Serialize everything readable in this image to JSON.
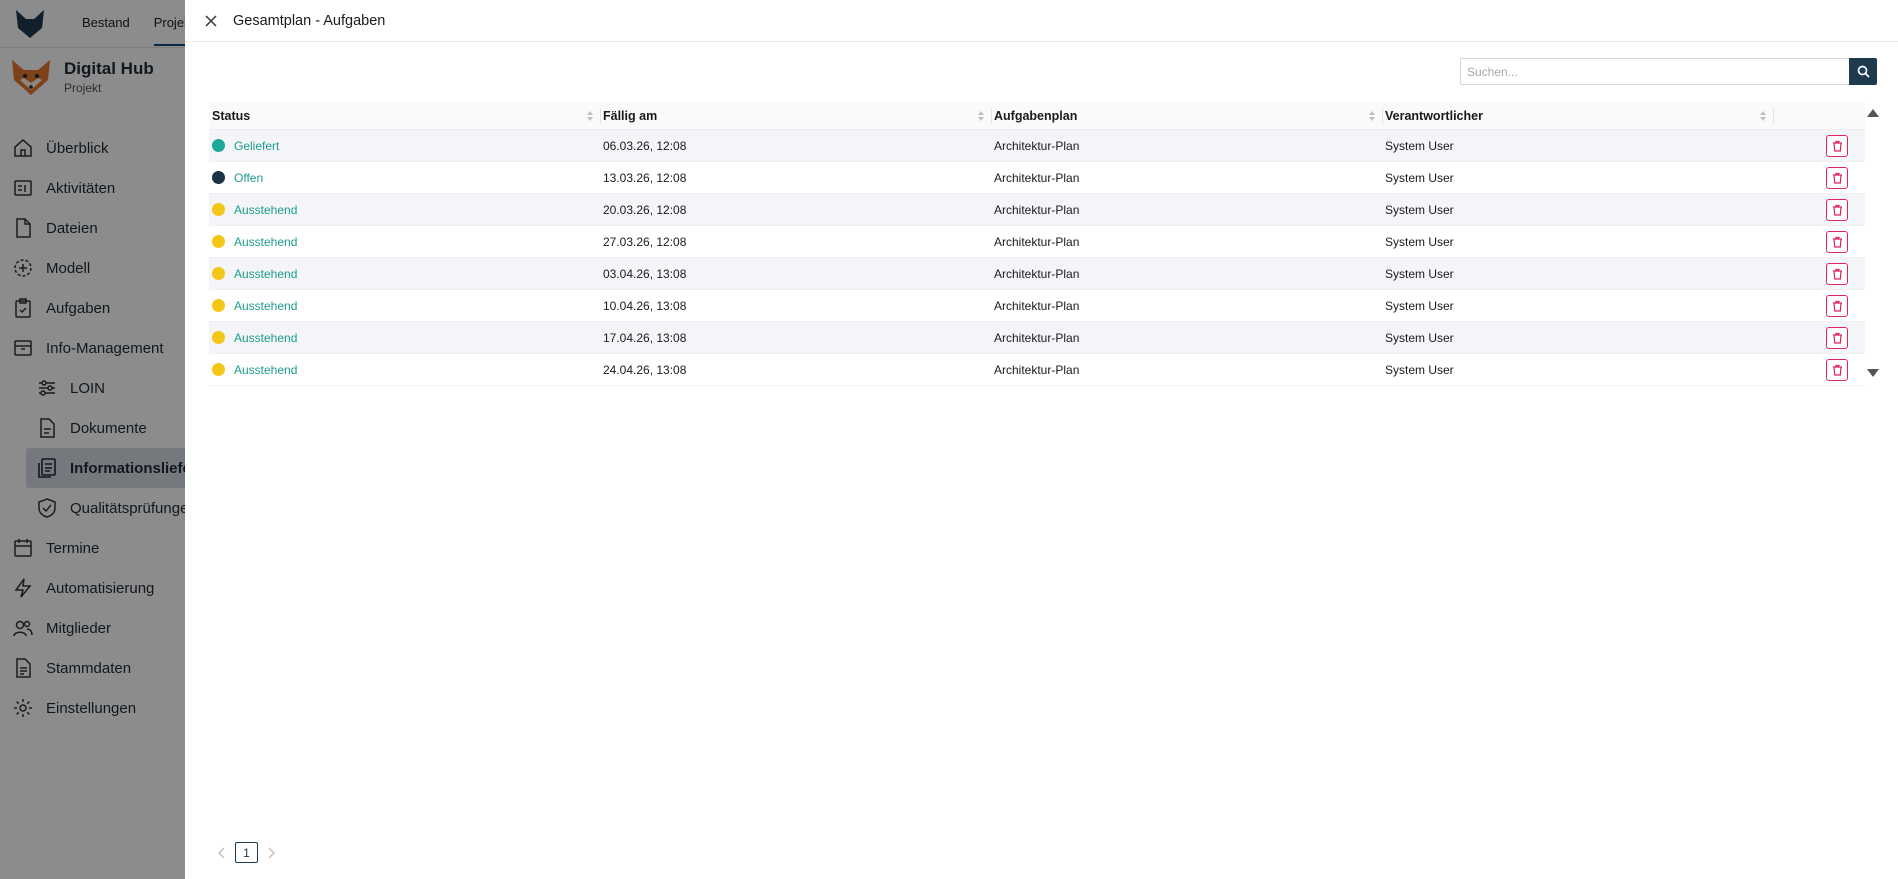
{
  "app": {
    "top_nav": [
      "Bestand",
      "Projekte"
    ],
    "project": {
      "title": "Digital Hub",
      "subtitle": "Projekt"
    },
    "sidebar": [
      {
        "label": "Überblick",
        "icon": "home-icon"
      },
      {
        "label": "Aktivitäten",
        "icon": "activity-icon"
      },
      {
        "label": "Dateien",
        "icon": "file-icon"
      },
      {
        "label": "Modell",
        "icon": "model-icon"
      },
      {
        "label": "Aufgaben",
        "icon": "clipboard-check-icon"
      },
      {
        "label": "Info-Management",
        "icon": "archive-icon"
      },
      {
        "label": "LOIN",
        "icon": "sliders-icon"
      },
      {
        "label": "Dokumente",
        "icon": "document-icon"
      },
      {
        "label": "Informationslieferungen",
        "icon": "copy-list-icon"
      },
      {
        "label": "Qualitätsprüfungen",
        "icon": "shield-check-icon"
      },
      {
        "label": "Termine",
        "icon": "calendar-icon"
      },
      {
        "label": "Automatisierung",
        "icon": "lightning-icon"
      },
      {
        "label": "Mitglieder",
        "icon": "users-icon"
      },
      {
        "label": "Stammdaten",
        "icon": "document-lines-icon"
      },
      {
        "label": "Einstellungen",
        "icon": "gear-icon"
      }
    ]
  },
  "drawer": {
    "title": "Gesamtplan - Aufgaben",
    "search": {
      "placeholder": "Suchen...",
      "value": ""
    },
    "columns": [
      "Status",
      "Fällig am",
      "Aufgabenplan",
      "Verantwortlicher"
    ],
    "rows": [
      {
        "status": "Geliefert",
        "status_color": "#1fa99a",
        "due": "06.03.26, 12:08",
        "plan": "Architektur-Plan",
        "responsible": "System User"
      },
      {
        "status": "Offen",
        "status_color": "#1b3346",
        "due": "13.03.26, 12:08",
        "plan": "Architektur-Plan",
        "responsible": "System User"
      },
      {
        "status": "Ausstehend",
        "status_color": "#f5c518",
        "due": "20.03.26, 12:08",
        "plan": "Architektur-Plan",
        "responsible": "System User"
      },
      {
        "status": "Ausstehend",
        "status_color": "#f5c518",
        "due": "27.03.26, 12:08",
        "plan": "Architektur-Plan",
        "responsible": "System User"
      },
      {
        "status": "Ausstehend",
        "status_color": "#f5c518",
        "due": "03.04.26, 13:08",
        "plan": "Architektur-Plan",
        "responsible": "System User"
      },
      {
        "status": "Ausstehend",
        "status_color": "#f5c518",
        "due": "10.04.26, 13:08",
        "plan": "Architektur-Plan",
        "responsible": "System User"
      },
      {
        "status": "Ausstehend",
        "status_color": "#f5c518",
        "due": "17.04.26, 13:08",
        "plan": "Architektur-Plan",
        "responsible": "System User"
      },
      {
        "status": "Ausstehend",
        "status_color": "#f5c518",
        "due": "24.04.26, 13:08",
        "plan": "Architektur-Plan",
        "responsible": "System User"
      }
    ],
    "pagination": {
      "current_page": "1"
    }
  },
  "colors": {
    "accent": "#1e3a4f",
    "link": "#1f9b8c",
    "danger": "#e0245e"
  }
}
